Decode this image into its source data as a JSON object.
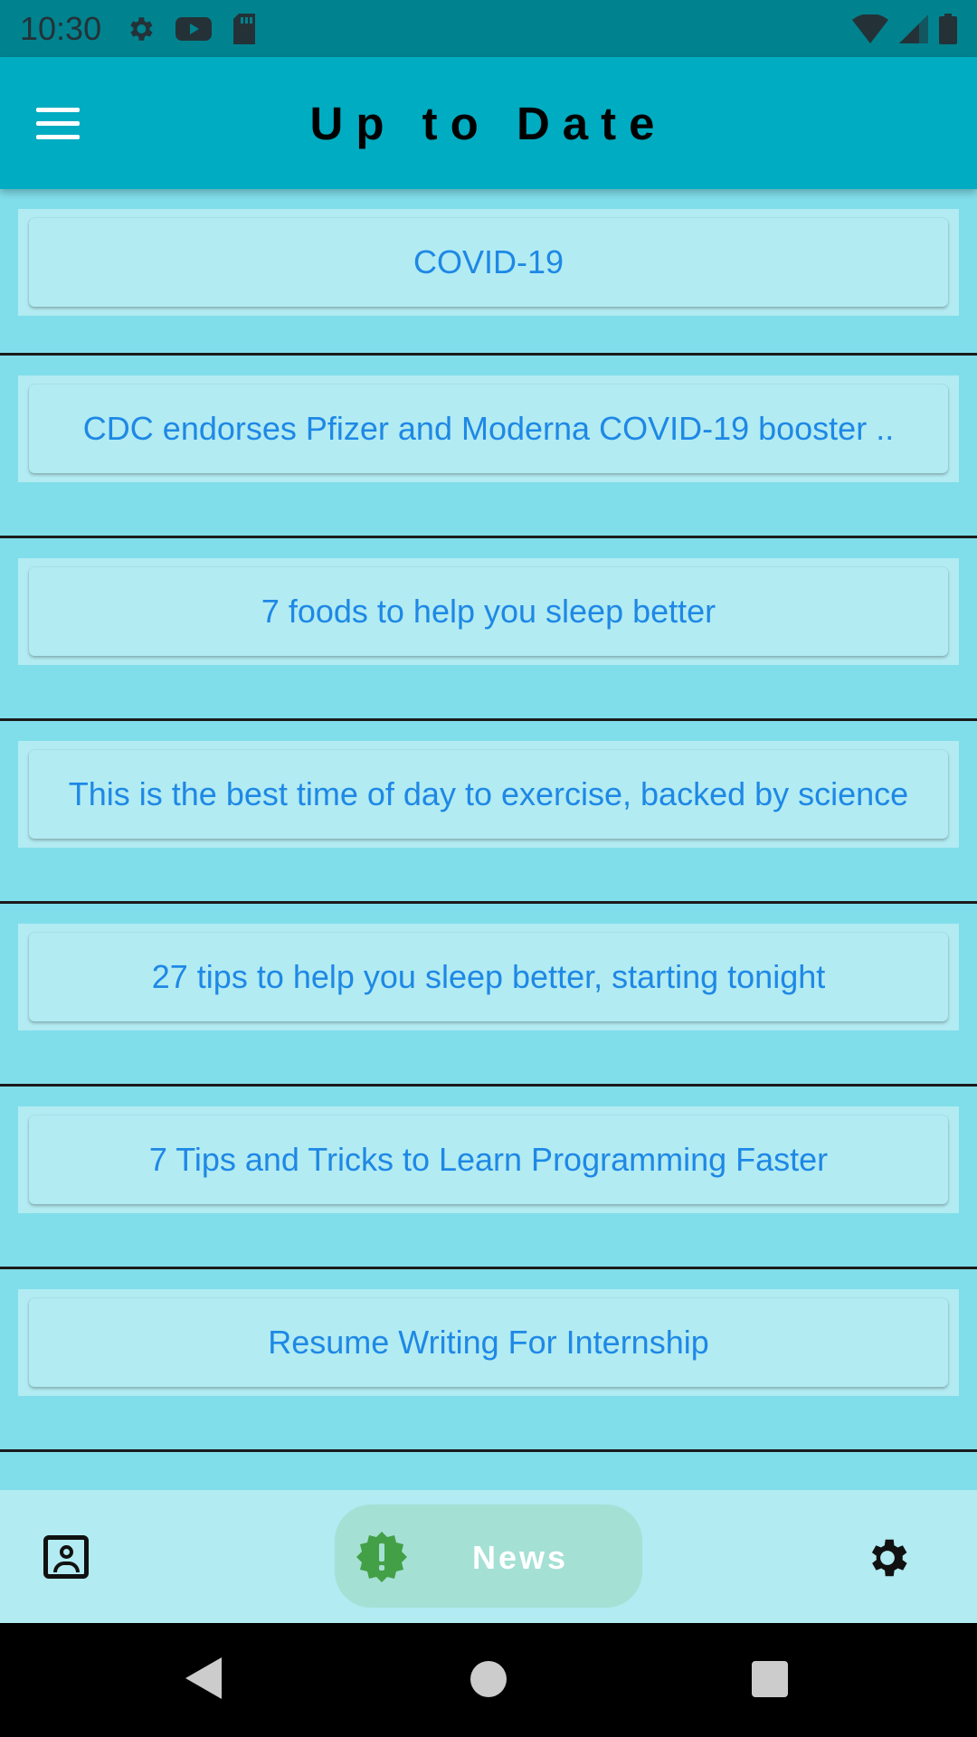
{
  "status_bar": {
    "time": "10:30",
    "icons": [
      "gear-icon",
      "youtube-icon",
      "sd-card-icon"
    ],
    "right_icons": [
      "wifi-icon",
      "signal-icon",
      "battery-icon"
    ]
  },
  "app_bar": {
    "title": "Up to Date",
    "menu_icon": "hamburger-menu-icon"
  },
  "news_items": [
    {
      "title": "COVID-19"
    },
    {
      "title": "CDC endorses Pfizer and Moderna COVID-19 booster .."
    },
    {
      "title": "7 foods to help you sleep better"
    },
    {
      "title": "This is the best time of day to exercise, backed by science"
    },
    {
      "title": "27 tips to help you sleep better, starting tonight"
    },
    {
      "title": "7 Tips and Tricks to Learn Programming Faster"
    },
    {
      "title": "Resume Writing For Internship"
    }
  ],
  "bottom_nav": {
    "items": [
      {
        "icon": "profile-icon"
      },
      {
        "icon": "news-alert-icon",
        "label": "News",
        "selected": true
      },
      {
        "icon": "settings-gear-icon"
      }
    ],
    "active_color": "#43a047"
  },
  "system_nav": {
    "icons": [
      "back-icon",
      "home-icon",
      "recents-icon"
    ]
  }
}
